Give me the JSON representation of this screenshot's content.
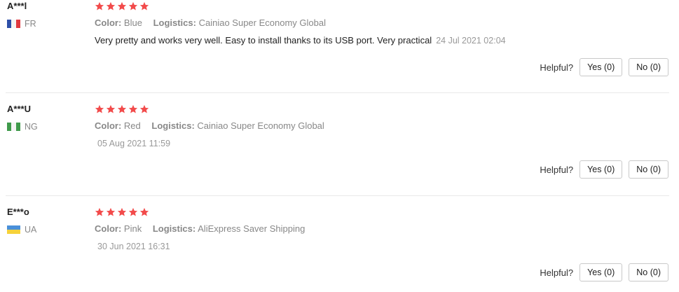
{
  "reviews": [
    {
      "user": "A***l",
      "country": "FR",
      "flag": "france",
      "rating": 5,
      "color_label": "Color:",
      "color_value": "Blue",
      "logistics_label": "Logistics:",
      "logistics_value": "Cainiao Super Economy Global",
      "text": "Very pretty and works very well. Easy to install thanks to its USB port. Very practical",
      "date": "24 Jul 2021 02:04",
      "helpful_label": "Helpful?",
      "yes_label": "Yes (0)",
      "no_label": "No (0)"
    },
    {
      "user": "A***U",
      "country": "NG",
      "flag": "nigeria",
      "rating": 5,
      "color_label": "Color:",
      "color_value": "Red",
      "logistics_label": "Logistics:",
      "logistics_value": "Cainiao Super Economy Global",
      "text": "",
      "date": "05 Aug 2021 11:59",
      "helpful_label": "Helpful?",
      "yes_label": "Yes (0)",
      "no_label": "No (0)"
    },
    {
      "user": "E***o",
      "country": "UA",
      "flag": "ukraine",
      "rating": 5,
      "color_label": "Color:",
      "color_value": "Pink",
      "logistics_label": "Logistics:",
      "logistics_value": "AliExpress Saver Shipping",
      "text": "",
      "date": "30 Jun 2021 16:31",
      "helpful_label": "Helpful?",
      "yes_label": "Yes (0)",
      "no_label": "No (0)"
    }
  ],
  "colors": {
    "star": "#f24b4b",
    "muted_text": "#888888",
    "divider": "#e8e8e8"
  }
}
